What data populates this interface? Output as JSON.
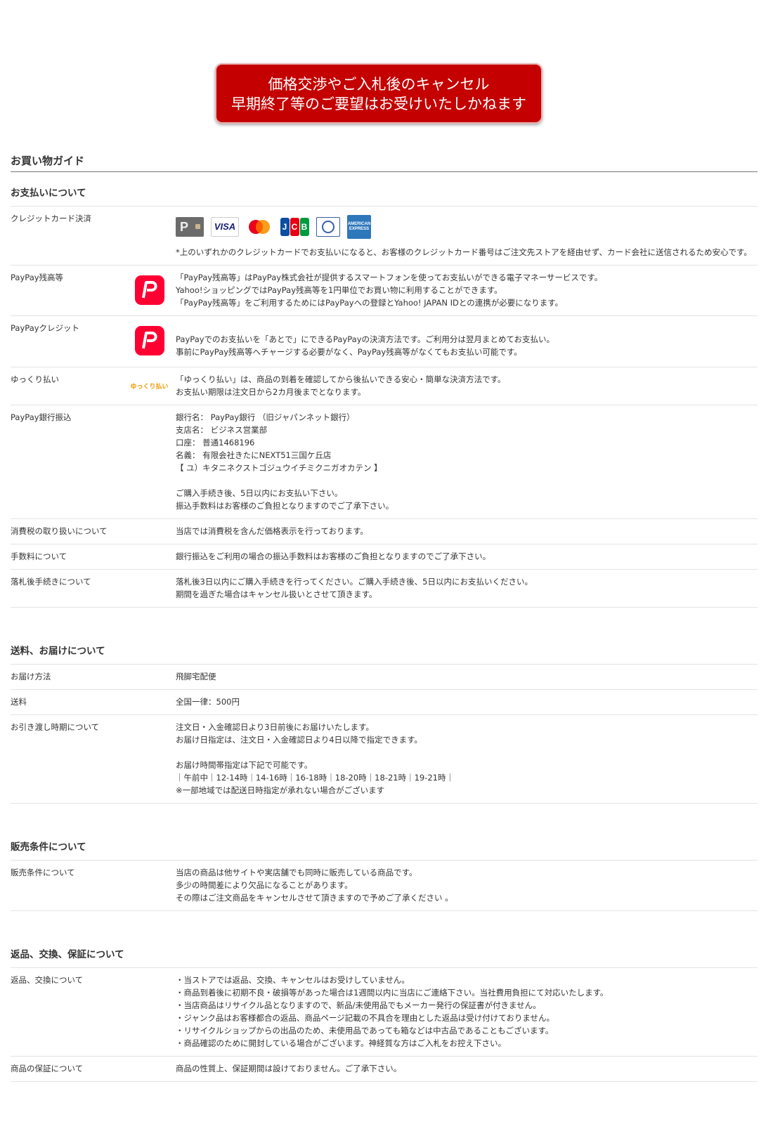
{
  "banner": {
    "line1": "価格交渉やご入札後のキャンセル",
    "line2": "早期終了等のご要望はお受けいたしかねます"
  },
  "guide_title": "お買い物ガイド",
  "payment": {
    "title": "お支払いについて",
    "credit": {
      "label": "クレジットカード決済",
      "cards": [
        "PayPay",
        "VISA",
        "Mastercard",
        "JCB",
        "Diners Club",
        "AMERICAN EXPRESS"
      ],
      "note": "*上のいずれかのクレジットカードでお支払いになると、お客様のクレジットカード番号はご注文先ストアを経由せず、カード会社に送信されるため安心です。"
    },
    "paypay_balance": {
      "label": "PayPay残高等",
      "lines": [
        "「PayPay残高等」はPayPay株式会社が提供するスマートフォンを使ってお支払いができる電子マネーサービスです。",
        "Yahoo!ショッピングではPayPay残高等を1円単位でお買い物に利用することができます。",
        "「PayPay残高等」をご利用するためにはPayPayへの登録とYahoo! JAPAN IDとの連携が必要になります。"
      ]
    },
    "paypay_credit": {
      "label": "PayPayクレジット",
      "lines": [
        "PayPayでのお支払いを「あとで」にできるPayPayの決済方法です。ご利用分は翌月まとめてお支払い。",
        "事前にPayPay残高等へチャージする必要がなく、PayPay残高等がなくてもお支払い可能です。"
      ]
    },
    "yukkuri": {
      "label": "ゆっくり払い",
      "logo_text": "ゆっくり払い",
      "lines": [
        "「ゆっくり払い」は、商品の到着を確認してから後払いできる安心・簡単な決済方法です。",
        "お支払い期限は注文日から2カ月後までとなります。"
      ]
    },
    "bank": {
      "label": "PayPay銀行振込",
      "lines": [
        "銀行名： PayPay銀行 （旧ジャパンネット銀行）",
        "支店名： ビジネス営業部",
        "口座： 普通1468196",
        "名義： 有限会社きたにNEXT51三国ケ丘店",
        "【 ユ）キタニネクストゴジュウイチミクニガオカテン 】",
        "",
        "ご購入手続き後、5日以内にお支払い下さい。",
        "振込手数料はお客様のご負担となりますのでご了承下さい。"
      ]
    },
    "tax": {
      "label": "消費税の取り扱いについて",
      "lines": [
        "当店では消費税を含んだ価格表示を行っております。"
      ]
    },
    "fee": {
      "label": "手数料について",
      "lines": [
        "銀行振込をご利用の場合の振込手数料はお客様のご負担となりますのでご了承下さい。"
      ]
    },
    "after_bid": {
      "label": "落札後手続きについて",
      "lines": [
        "落札後3日以内にご購入手続きを行ってください。ご購入手続き後、5日以内にお支払いください。",
        "期間を過ぎた場合はキャンセル扱いとさせて頂きます。"
      ]
    }
  },
  "shipping": {
    "title": "送料、お届けについて",
    "method": {
      "label": "お届け方法",
      "lines": [
        "飛脚宅配便"
      ]
    },
    "cost": {
      "label": "送料",
      "lines": [
        "全国一律：500円"
      ]
    },
    "timing": {
      "label": "お引き渡し時期について",
      "lines": [
        "注文日・入金確認日より3日前後にお届けいたします。",
        "お届け日指定は、注文日・入金確認日より4日以降で指定できます。",
        "",
        "お届け時間帯指定は下記で可能です。",
        "｜午前中｜12-14時｜14-16時｜16-18時｜18-20時｜18-21時｜19-21時｜",
        "※一部地域では配送日時指定が承れない場合がございます"
      ]
    }
  },
  "sales": {
    "title": "販売条件について",
    "conditions": {
      "label": "販売条件について",
      "lines": [
        "当店の商品は他サイトや実店舗でも同時に販売している商品です。",
        "多少の時間差により欠品になることがあります。",
        "その際はご注文商品をキャンセルさせて頂きますので予めご了承ください 。"
      ]
    }
  },
  "returns": {
    "title": "返品、交換、保証について",
    "returns_exchange": {
      "label": "返品、交換について",
      "lines": [
        "・当ストアでは返品、交換、キャンセルはお受けしていません。",
        "・商品到着後に初期不良・破損等があった場合は1週間以内に当店にご連絡下さい。当社費用負担にて対応いたします。",
        "・当店商品はリサイクル品となりますので、新品/未使用品でもメーカー発行の保証書が付きません。",
        "・ジャンク品はお客様都合の返品、商品ページ記載の不具合を理由とした返品は受け付けておりません。",
        "・リサイクルショップからの出品のため、未使用品であっても箱などは中古品であることもございます。",
        "・商品確認のために開封している場合がございます。神経質な方はご入札をお控え下さい。"
      ]
    },
    "warranty": {
      "label": "商品の保証について",
      "lines": [
        "商品の性質上、保証期間は設けておりません。ご了承下さい。"
      ]
    }
  }
}
